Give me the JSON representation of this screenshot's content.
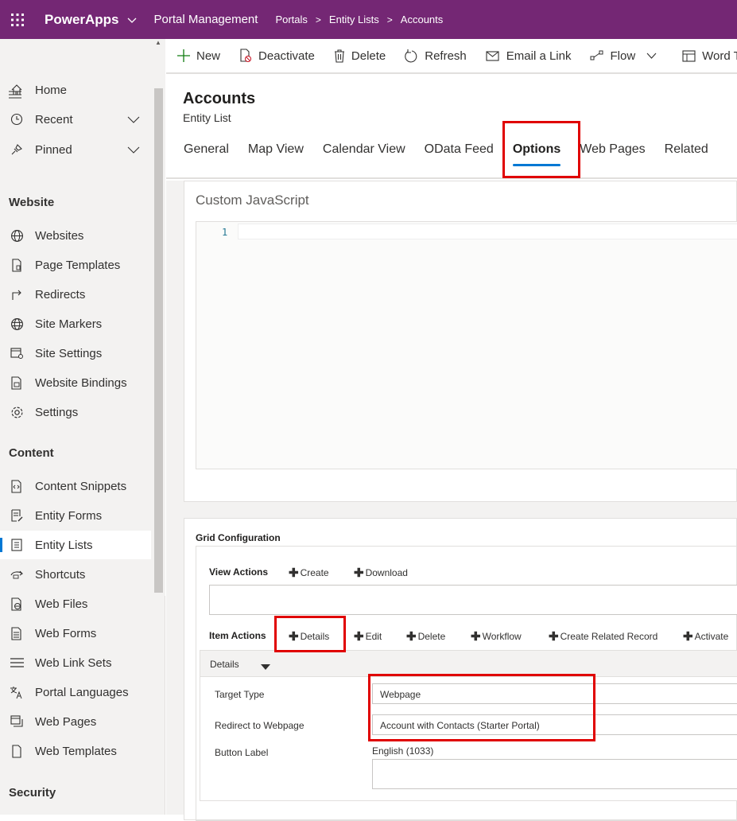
{
  "topbar": {
    "app_name": "PowerApps",
    "portal_name": "Portal Management",
    "breadcrumbs": [
      "Portals",
      "Entity Lists",
      "Accounts"
    ],
    "color": "#742774"
  },
  "sidebar": {
    "items_top": [
      {
        "label": "Home",
        "icon": "home-icon"
      },
      {
        "label": "Recent",
        "icon": "clock-icon",
        "expandable": true
      },
      {
        "label": "Pinned",
        "icon": "pin-icon",
        "expandable": true
      }
    ],
    "website_section": "Website",
    "website_items": [
      {
        "label": "Websites",
        "icon": "globe-icon"
      },
      {
        "label": "Page Templates",
        "icon": "page-template-icon"
      },
      {
        "label": "Redirects",
        "icon": "redirect-icon"
      },
      {
        "label": "Site Markers",
        "icon": "site-marker-icon"
      },
      {
        "label": "Site Settings",
        "icon": "site-settings-icon"
      },
      {
        "label": "Website Bindings",
        "icon": "binding-icon"
      },
      {
        "label": "Settings",
        "icon": "gear-icon"
      }
    ],
    "content_section": "Content",
    "content_items": [
      {
        "label": "Content Snippets",
        "icon": "snippet-icon"
      },
      {
        "label": "Entity Forms",
        "icon": "form-icon"
      },
      {
        "label": "Entity Lists",
        "icon": "list-icon",
        "active": true
      },
      {
        "label": "Shortcuts",
        "icon": "shortcut-icon"
      },
      {
        "label": "Web Files",
        "icon": "web-file-icon"
      },
      {
        "label": "Web Forms",
        "icon": "web-form-icon"
      },
      {
        "label": "Web Link Sets",
        "icon": "link-set-icon"
      },
      {
        "label": "Portal Languages",
        "icon": "language-icon"
      },
      {
        "label": "Web Pages",
        "icon": "web-pages-icon"
      },
      {
        "label": "Web Templates",
        "icon": "web-template-icon"
      }
    ],
    "security_section": "Security"
  },
  "commandbar": {
    "new": "New",
    "deactivate": "Deactivate",
    "delete": "Delete",
    "refresh": "Refresh",
    "email": "Email a Link",
    "flow": "Flow",
    "word": "Word Ter"
  },
  "record": {
    "title": "Accounts",
    "subtitle": "Entity List",
    "tabs": [
      "General",
      "Map View",
      "Calendar View",
      "OData Feed",
      "Options",
      "Web Pages",
      "Related"
    ],
    "active_tab": "Options"
  },
  "custom_js": {
    "title": "Custom JavaScript",
    "line_number": "1"
  },
  "grid": {
    "title": "Grid Configuration",
    "view_actions_label": "View Actions",
    "view_actions": [
      "Create",
      "Download"
    ],
    "item_actions_label": "Item Actions",
    "item_actions": [
      "Details",
      "Edit",
      "Delete",
      "Workflow",
      "Create Related Record",
      "Activate"
    ],
    "details": {
      "header": "Details",
      "target_type_label": "Target Type",
      "target_type_value": "Webpage",
      "redirect_label": "Redirect to Webpage",
      "redirect_value": "Account with Contacts (Starter Portal)",
      "button_label_label": "Button Label",
      "language": "English (1033)"
    }
  },
  "highlight_color": "#e00000"
}
